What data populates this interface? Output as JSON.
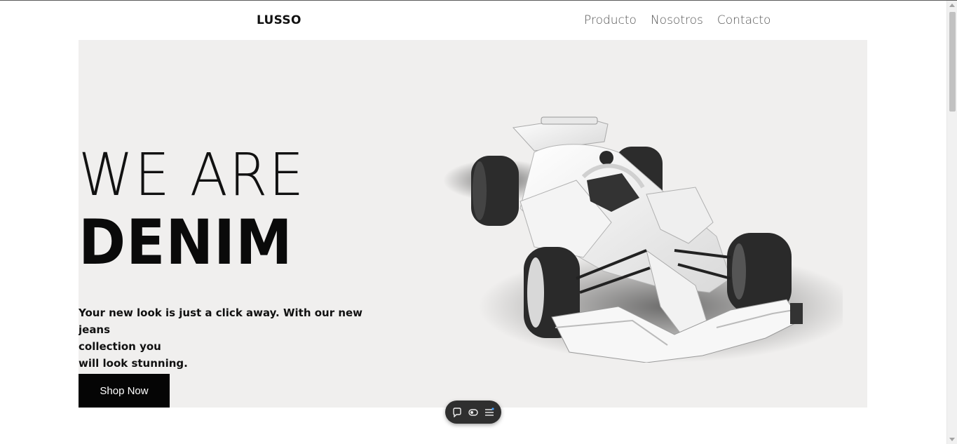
{
  "header": {
    "logo": "LUSSO",
    "nav": [
      "Producto",
      "Nosotros",
      "Contacto"
    ]
  },
  "hero": {
    "line1": "WE ARE",
    "line2": "DENIM",
    "tagline": [
      "Your new look is just a click away. With our new jeans",
      "collection you",
      "will look stunning."
    ],
    "cta": "Shop Now",
    "background": "#f0efee"
  },
  "floating_toolbar": {
    "icons": [
      "comment-icon",
      "toggle-view-icon",
      "menu-list-icon"
    ]
  },
  "colors": {
    "button_bg": "#050505",
    "nav_text": "#555555"
  }
}
